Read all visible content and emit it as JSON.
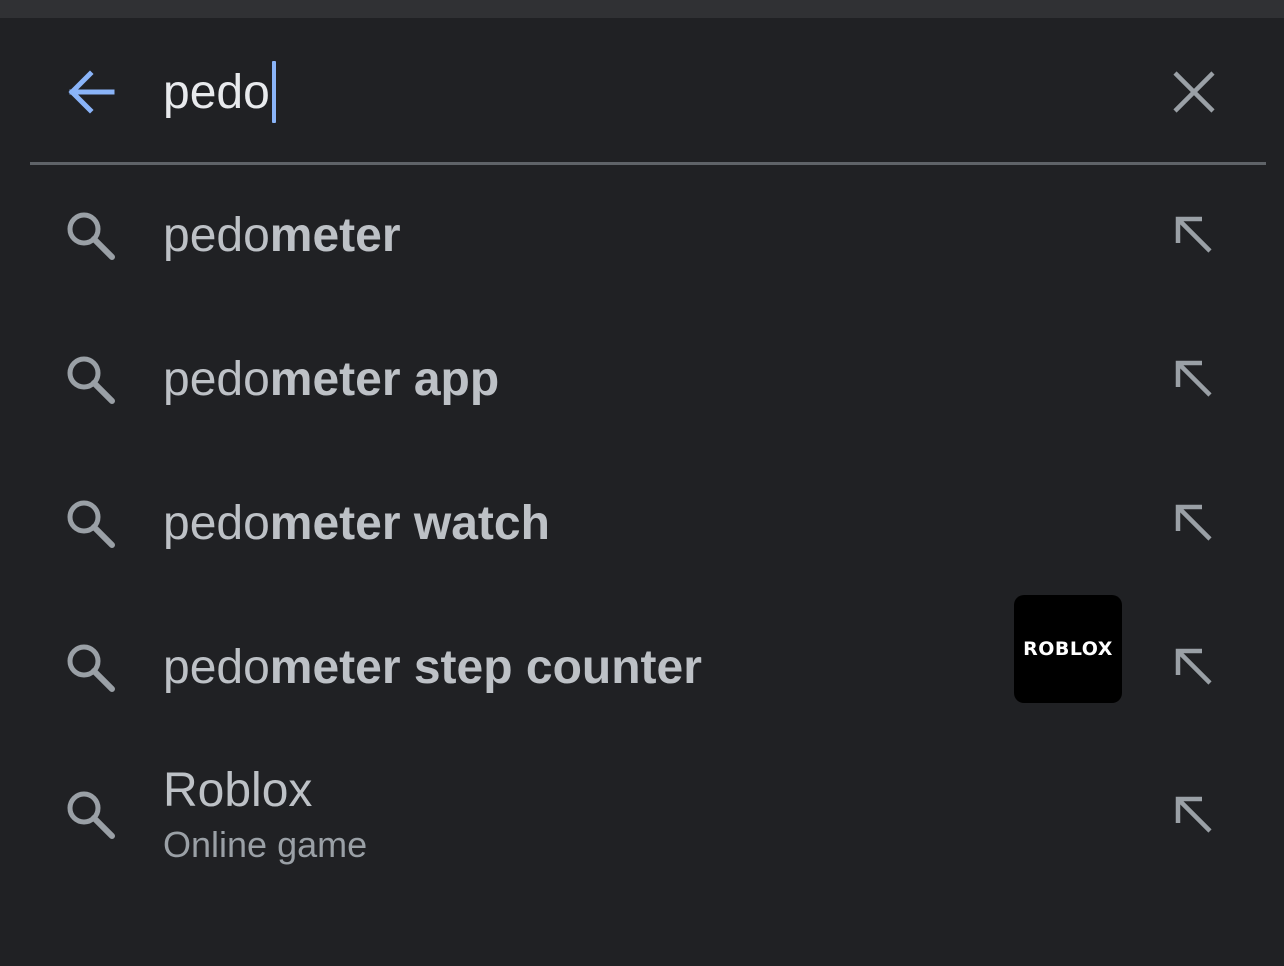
{
  "search": {
    "query": "pedo",
    "back_icon": "arrow-left-icon",
    "clear_icon": "close-icon",
    "accent_color": "#8ab4f8"
  },
  "suggestions": [
    {
      "typed": "pedo",
      "completion": "meter",
      "icon": "search-icon",
      "action_icon": "arrow-up-left-icon"
    },
    {
      "typed": "pedo",
      "completion": "meter app",
      "icon": "search-icon",
      "action_icon": "arrow-up-left-icon"
    },
    {
      "typed": "pedo",
      "completion": "meter watch",
      "icon": "search-icon",
      "action_icon": "arrow-up-left-icon"
    },
    {
      "typed": "pedo",
      "completion": "meter step counter",
      "icon": "search-icon",
      "action_icon": "arrow-up-left-icon"
    }
  ],
  "app_suggestion": {
    "title": "Roblox",
    "subtitle": "Online game",
    "logo_text": "ROBLOX",
    "icon": "search-icon",
    "action_icon": "arrow-up-left-icon"
  },
  "colors": {
    "background": "#202124",
    "text": "#bdc1c6",
    "query_text": "#e8eaed",
    "divider": "#5f6368"
  }
}
